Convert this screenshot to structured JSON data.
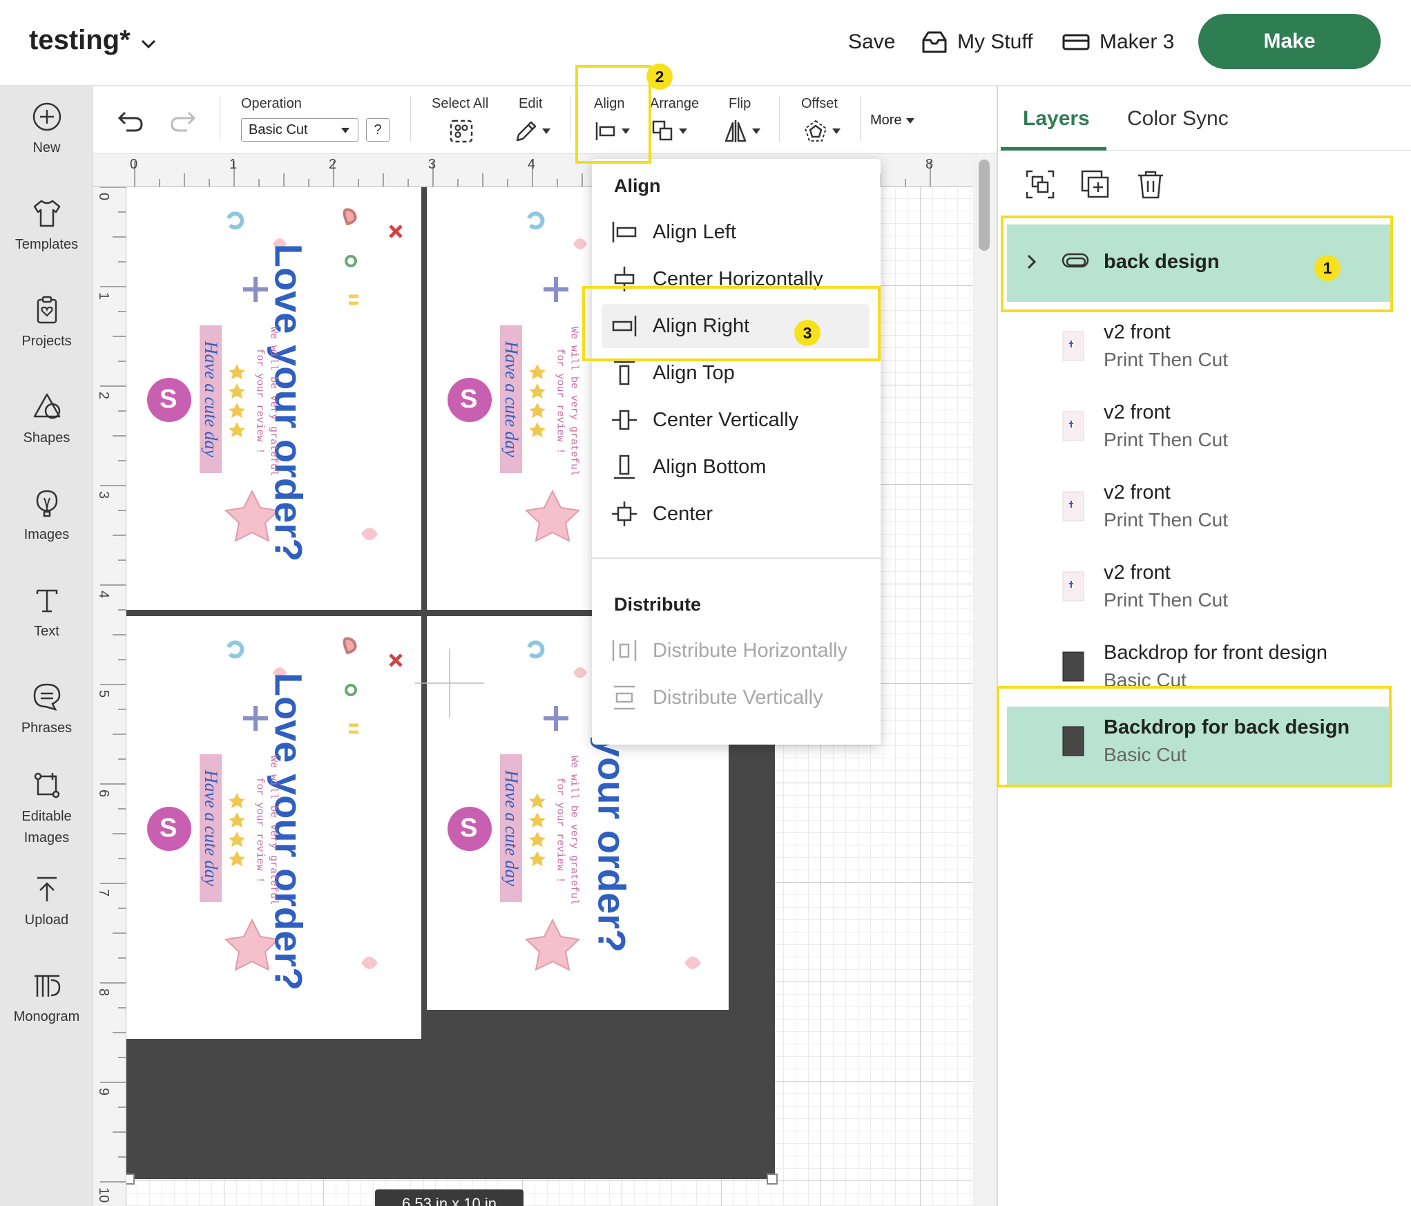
{
  "app": {
    "document_title": "testing*",
    "save_label": "Save",
    "my_stuff_label": "My Stuff",
    "machine_label": "Maker 3",
    "make_label": "Make"
  },
  "sidebar": {
    "items": [
      {
        "label": "New",
        "icon": "plus-circle-icon"
      },
      {
        "label": "Templates",
        "icon": "tshirt-icon"
      },
      {
        "label": "Projects",
        "icon": "clipboard-heart-icon"
      },
      {
        "label": "Shapes",
        "icon": "shapes-icon"
      },
      {
        "label": "Images",
        "icon": "balloon-icon"
      },
      {
        "label": "Text",
        "icon": "text-icon"
      },
      {
        "label": "Phrases",
        "icon": "speech-bubble-icon"
      },
      {
        "label": "Editable Images",
        "icon": "editable-image-icon"
      },
      {
        "label": "Upload",
        "icon": "upload-icon"
      },
      {
        "label": "Monogram",
        "icon": "monogram-icon"
      }
    ]
  },
  "toolbar": {
    "operation_label": "Operation",
    "operation_value": "Basic Cut",
    "help_label": "?",
    "select_all_label": "Select All",
    "edit_label": "Edit",
    "align_label": "Align",
    "arrange_label": "Arrange",
    "flip_label": "Flip",
    "offset_label": "Offset",
    "more_label": "More"
  },
  "rulers": {
    "horizontal": [
      "0",
      "1",
      "2",
      "3",
      "4",
      "8"
    ],
    "vertical": [
      "0",
      "1",
      "2",
      "3",
      "4",
      "5",
      "6",
      "7",
      "8",
      "9",
      "10"
    ]
  },
  "canvas": {
    "card_heading": "Love your order?",
    "card_cropped_heading": "your order?",
    "card_body_line1": "We will be very grateful",
    "card_body_line2": "for your review !",
    "card_tagline": "Have a cute day",
    "logo_text": "S",
    "size_label": "6.53 in x 10 in"
  },
  "align_menu": {
    "align_heading": "Align",
    "items": [
      {
        "label": "Align Left",
        "icon": "align-left-icon"
      },
      {
        "label": "Center Horizontally",
        "icon": "center-horizontally-icon"
      },
      {
        "label": "Align Right",
        "icon": "align-right-icon"
      },
      {
        "label": "Align Top",
        "icon": "align-top-icon"
      },
      {
        "label": "Center Vertically",
        "icon": "center-vertically-icon"
      },
      {
        "label": "Align Bottom",
        "icon": "align-bottom-icon"
      },
      {
        "label": "Center",
        "icon": "center-icon"
      }
    ],
    "distribute_heading": "Distribute",
    "distribute_items": [
      {
        "label": "Distribute Horizontally",
        "icon": "distribute-horizontally-icon"
      },
      {
        "label": "Distribute Vertically",
        "icon": "distribute-vertically-icon"
      }
    ]
  },
  "layers_panel": {
    "tabs": [
      "Layers",
      "Color Sync"
    ],
    "layers": [
      {
        "name": "back design",
        "sub": ""
      },
      {
        "name": "v2 front",
        "sub": "Print Then Cut"
      },
      {
        "name": "v2 front",
        "sub": "Print Then Cut"
      },
      {
        "name": "v2 front",
        "sub": "Print Then Cut"
      },
      {
        "name": "v2 front",
        "sub": "Print Then Cut"
      },
      {
        "name": "Backdrop for front design",
        "sub": "Basic Cut"
      },
      {
        "name": "Backdrop for back design",
        "sub": "Basic Cut"
      }
    ]
  },
  "annotations": {
    "badge_1": "1",
    "badge_2": "2",
    "badge_3": "3",
    "highlight_color": "#f4dd1e"
  },
  "colors": {
    "brand_green": "#2f7d53",
    "selected_layer": "#b7e3d0",
    "card_heading_blue": "#2f5fc0",
    "tagline_pink": "#e8b8d0"
  }
}
